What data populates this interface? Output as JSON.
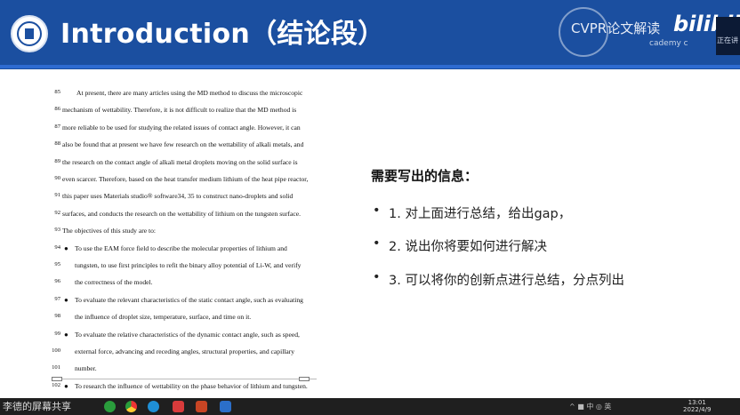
{
  "header": {
    "title": "Introduction（结论段）",
    "watermark": "CVPR论文解读",
    "watermark_sub": "cademy c",
    "brand": "bilibili",
    "corner_text": "正在讲"
  },
  "document": {
    "lines": [
      {
        "num": "85",
        "text": "At present, there are many articles using the MD method to discuss the microscopic",
        "style": "indent1",
        "bullet": ""
      },
      {
        "num": "86",
        "text": "mechanism of wettability. Therefore, it is not difficult to realize that the MD method is",
        "style": "",
        "bullet": ""
      },
      {
        "num": "87",
        "text": "more reliable to be used for studying the related issues of contact angle. However, it can",
        "style": "",
        "bullet": ""
      },
      {
        "num": "88",
        "text": "also be found that at present we have few research on the wettability of alkali metals, and",
        "style": "",
        "bullet": ""
      },
      {
        "num": "89",
        "text": "the research on the contact angle of alkali metal droplets moving on the solid surface is",
        "style": "",
        "bullet": ""
      },
      {
        "num": "90",
        "text": "even scarcer. Therefore, based on the heat transfer medium lithium of the heat pipe reactor,",
        "style": "",
        "bullet": ""
      },
      {
        "num": "91",
        "text": "this paper uses Materials studio® software34, 35 to construct nano-droplets and solid",
        "style": "",
        "bullet": ""
      },
      {
        "num": "92",
        "text": "surfaces, and conducts the research on the wettability of lithium on the tungsten surface.",
        "style": "",
        "bullet": ""
      },
      {
        "num": "93",
        "text": "The objectives of this study are to:",
        "style": "",
        "bullet": ""
      },
      {
        "num": "94",
        "text": "To use the EAM force field to describe the molecular properties of lithium and",
        "style": "indent-bullet",
        "bullet": "●"
      },
      {
        "num": "95",
        "text": "tungsten, to use first principles to refit the binary alloy potential of Li-W, and verify",
        "style": "indent-bullet",
        "bullet": ""
      },
      {
        "num": "96",
        "text": "the correctness of the model.",
        "style": "indent-bullet",
        "bullet": ""
      },
      {
        "num": "97",
        "text": "To evaluate the relevant characteristics of the static contact angle, such as evaluating",
        "style": "indent-bullet",
        "bullet": "●"
      },
      {
        "num": "98",
        "text": "the influence of droplet size, temperature, surface, and time on it.",
        "style": "indent-bullet",
        "bullet": ""
      },
      {
        "num": "99",
        "text": "To evaluate the relative characteristics of the dynamic contact angle, such as speed,",
        "style": "indent-bullet",
        "bullet": "●"
      },
      {
        "num": "100",
        "text": "external force, advancing and receding angles, structural properties, and capillary",
        "style": "indent-bullet",
        "bullet": ""
      },
      {
        "num": "101",
        "text": "number.",
        "style": "indent-bullet",
        "bullet": ""
      },
      {
        "num": "102",
        "text": "To research the influence of wettability on the phase behavior of lithium and tungsten.",
        "style": "indent-bullet",
        "bullet": "●"
      }
    ]
  },
  "info": {
    "heading": "需要写出的信息：",
    "items": [
      "1. 对上面进行总结，给出gap，",
      "2. 说出你将要如何进行解决",
      "3. 可以将你的创新点进行总结，分点列出"
    ],
    "bullet": "•"
  },
  "taskbar": {
    "share_label": "李德的屏幕共享",
    "tray": "^ ■ 中 ◎ 英",
    "time": "13:01",
    "date": "2022/4/9"
  },
  "colors": {
    "header_bg": "#1b4fa0",
    "header_accent": "#2e6bd1",
    "taskbar_bg": "#1f1f1f"
  }
}
